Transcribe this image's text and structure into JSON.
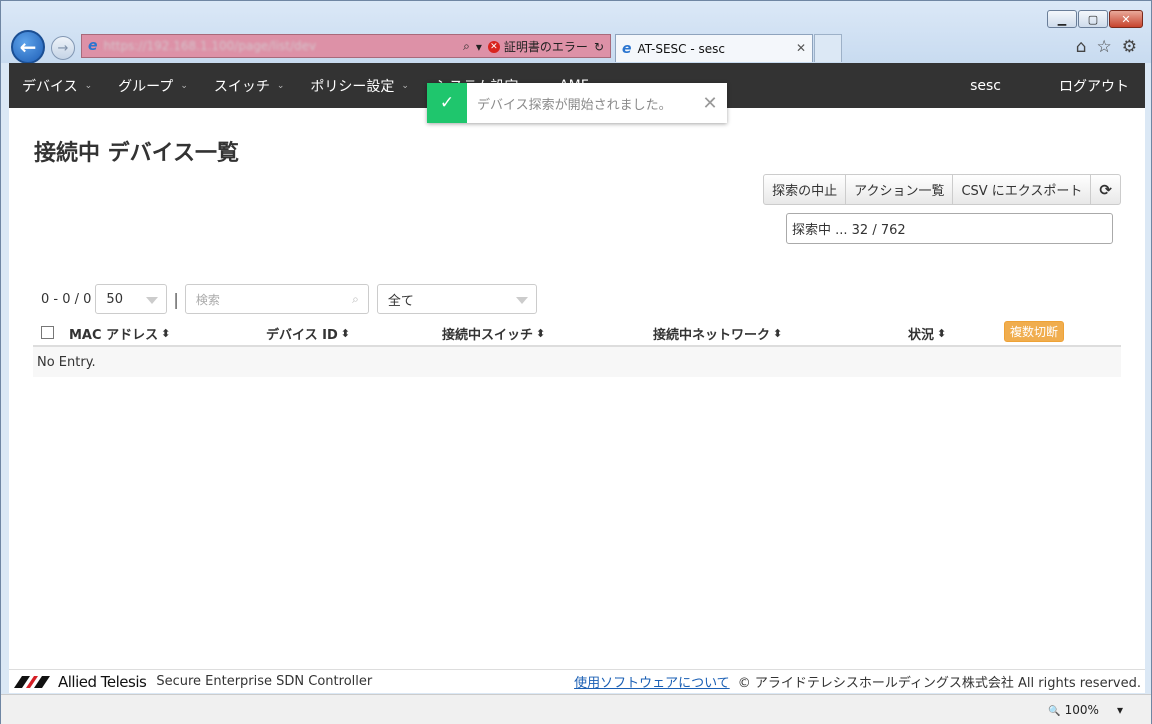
{
  "browser": {
    "url": "https://192.168.1.100/page/list/dev",
    "cert_error": "証明書のエラー",
    "tab_title": "AT-SESC - sesc",
    "zoom": "100%",
    "win_controls": {
      "minimize": "▁",
      "maximize": "▢",
      "close": "✕"
    },
    "icons": {
      "back": "←",
      "forward": "→",
      "search": "⌕",
      "dropdown": "▾",
      "refresh": "↻",
      "close": "✕",
      "home": "⌂",
      "favorites": "☆",
      "settings": "⚙",
      "zoom": "🔍"
    }
  },
  "nav": {
    "items": [
      {
        "label": "デバイス"
      },
      {
        "label": "グループ"
      },
      {
        "label": "スイッチ"
      },
      {
        "label": "ポリシー設定"
      },
      {
        "label": "システム設定"
      },
      {
        "label": "AMF"
      }
    ],
    "caret": "⌄",
    "user": "sesc",
    "logout": "ログアウト"
  },
  "toast": {
    "message": "デバイス探索が開始されました。",
    "check_icon": "✓",
    "close_icon": "✕"
  },
  "page": {
    "title": "接続中 デバイス一覧"
  },
  "actions": {
    "stop_discovery": "探索の中止",
    "action_list": "アクション一覧",
    "csv_export": "CSV にエクスポート",
    "refresh_icon": "⟳"
  },
  "progress": {
    "text": "探索中 ... 32 / 762"
  },
  "filters": {
    "range": "0 - 0 / 0",
    "page_size": "50",
    "separator": "|",
    "search_placeholder": "検索",
    "search_icon": "⌕",
    "status_filter": "全て"
  },
  "table": {
    "columns": [
      "MAC アドレス",
      "デバイス ID",
      "接続中スイッチ",
      "接続中ネットワーク",
      "状況"
    ],
    "sort_icon": "⬍",
    "bulk_disconnect": "複数切断",
    "empty_message": "No Entry."
  },
  "footer": {
    "brand": "Allied Telesis",
    "product": "Secure Enterprise SDN Controller",
    "software_link": "使用ソフトウェアについて",
    "copyright": "© アライドテレシスホールディングス株式会社 All rights reserved."
  },
  "colors": {
    "navbar_bg": "#333333",
    "toast_success": "#1fc66d",
    "bulk_button": "#f0ad4e",
    "address_error": "#dd91a7"
  }
}
